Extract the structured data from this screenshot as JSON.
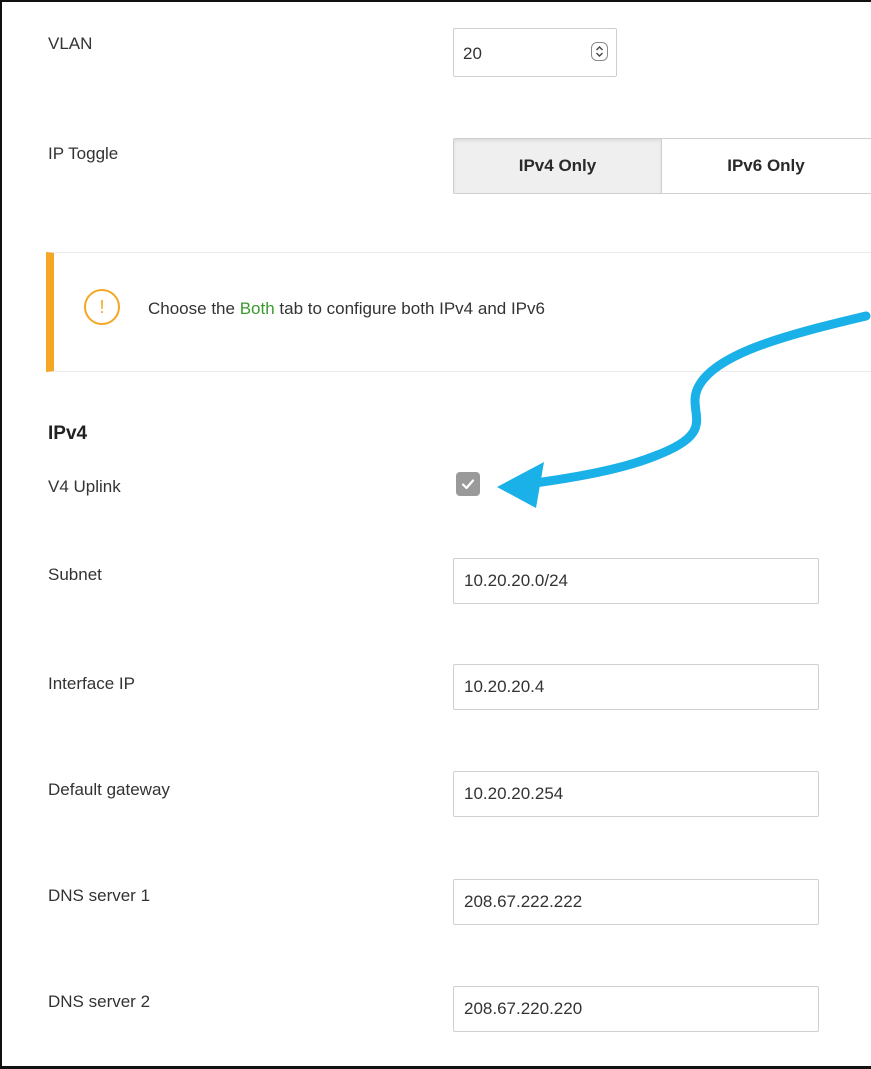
{
  "vlan": {
    "label": "VLAN",
    "value": "20"
  },
  "ip_toggle": {
    "label": "IP Toggle",
    "options": [
      "IPv4 Only",
      "IPv6 Only"
    ],
    "selected": "IPv4 Only"
  },
  "notice": {
    "icon": "exclamation-circle-icon",
    "text_before": "Choose the ",
    "highlight": "Both",
    "text_after": " tab to configure both IPv4 and IPv6",
    "accent_color": "#f5a623",
    "highlight_color": "#3a9a2f"
  },
  "ipv4": {
    "section_title": "IPv4",
    "uplink_label": "V4 Uplink",
    "uplink_checked": true,
    "fields": [
      {
        "label": "Subnet",
        "value": "10.20.20.0/24"
      },
      {
        "label": "Interface IP",
        "value": "10.20.20.4"
      },
      {
        "label": "Default gateway",
        "value": "10.20.20.254"
      },
      {
        "label": "DNS server 1",
        "value": "208.67.222.222"
      },
      {
        "label": "DNS server 2",
        "value": "208.67.220.220"
      }
    ]
  },
  "annotation": {
    "arrow_color": "#1ab0e8"
  }
}
